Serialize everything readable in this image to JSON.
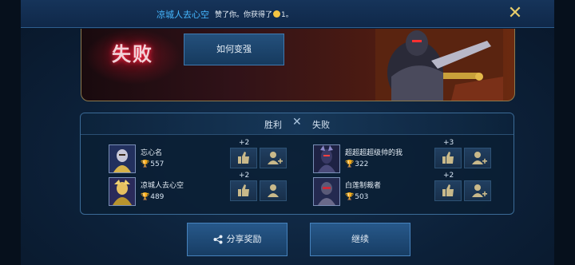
{
  "notification": {
    "player_name": "凉城人去心空",
    "message_pre": "赞了你。你获得了",
    "message_post": "1。",
    "close_icon": "close-x-icon"
  },
  "banner": {
    "result_title": "失败",
    "improve_label": "如何变强"
  },
  "results": {
    "win_label": "胜利",
    "vs_icon": "crossed-swords-icon",
    "lose_label": "失败"
  },
  "players": [
    {
      "name": "忘心名",
      "score": "557",
      "bonus": "+2"
    },
    {
      "name": "凉城人去心空",
      "score": "489",
      "bonus": "+2"
    },
    {
      "name": "超超超超级帅的我",
      "score": "322",
      "bonus": "+3"
    },
    {
      "name": "白莲制裁者",
      "score": "503",
      "bonus": "+2"
    }
  ],
  "actions": {
    "share_label": "分享奖励",
    "continue_label": "继续"
  },
  "colors": {
    "accent_blue": "#46b7ff",
    "gold": "#e7cc6b",
    "defeat_red": "#ff2a45"
  }
}
